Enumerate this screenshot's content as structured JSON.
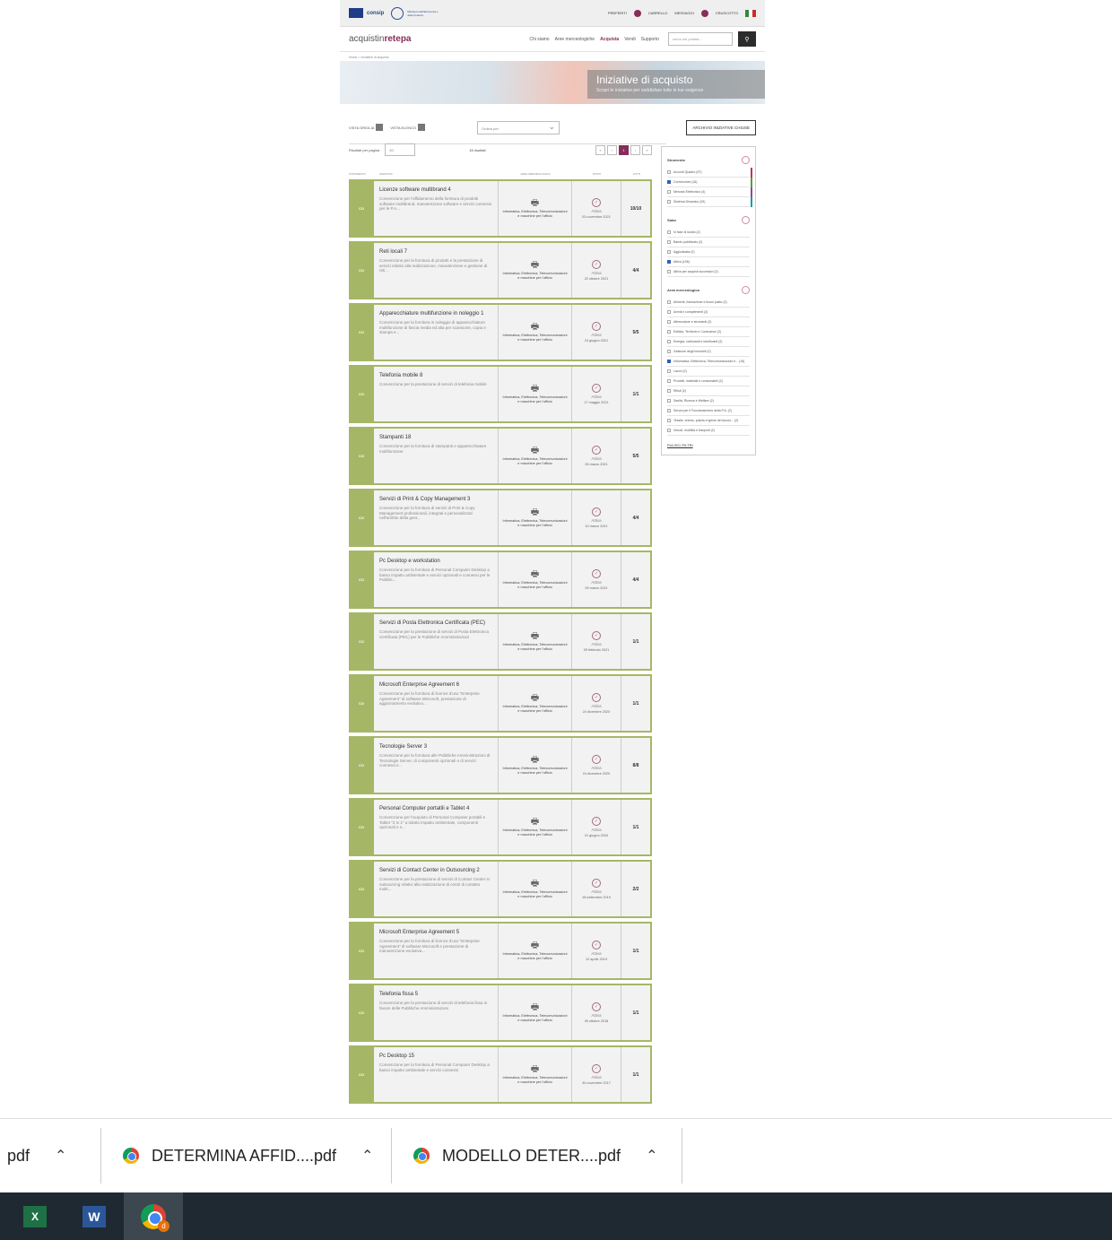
{
  "site": {
    "topbar": {
      "consip": "consip",
      "mef": "MEF",
      "mef_sub": "Ministero dell'Economia e delle Finanze",
      "links": [
        "Preferiti",
        "Carrello",
        "Messaggi",
        "Cruscotto"
      ]
    },
    "header": {
      "logo_a": "acquistin",
      "logo_b": "retepa",
      "nav": [
        "Chi siamo",
        "Aree merceologiche",
        "Acquista",
        "Vendi",
        "Supporto"
      ],
      "search_placeholder": "cerca nel portale..."
    },
    "breadcrumb": "Home > Iniziative di acquisto",
    "hero": {
      "title": "Iniziative di acquisto",
      "subtitle": "Scopri le iniziative per soddisfare tutte le tue esigenze"
    },
    "toolbar": {
      "view_grid": "VISTA GRIGLIA",
      "view_list": "VISTA ELENCO",
      "sort": "Ordina per",
      "archive": "ARCHIVIO INIZIATIVE CHIUSE"
    },
    "list": {
      "per_page_label": "Risultati per pagina",
      "per_page": "20",
      "results": "16 risultati",
      "pages": [
        "«",
        "‹",
        "1",
        "›",
        "»"
      ],
      "columns": [
        "Strumento",
        "Iniziativa",
        "Area merceologica",
        "Stato",
        "Lotti"
      ],
      "cards": [
        {
          "tag": "CO",
          "title": "Licenze software multibrand 4",
          "desc": "Convenzione per l'affidamento della fornitura di prodotti software multibrand, manutenzione software e servizi connessi per le P.A...",
          "cat": "Informatica, Elettronica, Telecomunicazioni e macchine per l'ufficio",
          "status": "Attiva",
          "date": "03 novembre 2021",
          "lots": "10/10"
        },
        {
          "tag": "CO",
          "title": "Reti locali 7",
          "desc": "Convenzione per la fornitura di prodotti e la prestazione di servizi relativi alla realizzazione, manutenzione e gestione di reti...",
          "cat": "Informatica, Elettronica, Telecomunicazioni e macchine per l'ufficio",
          "status": "Attiva",
          "date": "22 ottobre 2021",
          "lots": "4/4"
        },
        {
          "tag": "CO",
          "title": "Apparecchiature multifunzione in noleggio 1",
          "desc": "Convenzione per la fornitura in noleggio di apparecchiature multifunzione di fascia media ed alta per scansione, copia e stampa e...",
          "cat": "Informatica, Elettronica, Telecomunicazioni e macchine per l'ufficio",
          "status": "Attiva",
          "date": "24 giugno 2021",
          "lots": "5/5"
        },
        {
          "tag": "CO",
          "title": "Telefonia mobile 8",
          "desc": "Convenzione per la prestazione di servizi di telefonia mobile",
          "cat": "Informatica, Elettronica, Telecomunicazioni e macchine per l'ufficio",
          "status": "Attiva",
          "date": "17 maggio 2021",
          "lots": "1/1"
        },
        {
          "tag": "CO",
          "title": "Stampanti 18",
          "desc": "Convenzione per la fornitura di stampanti e apparecchiature multifunzione",
          "cat": "Informatica, Elettronica, Telecomunicazioni e macchine per l'ufficio",
          "status": "Attiva",
          "date": "26 marzo 2021",
          "lots": "5/5"
        },
        {
          "tag": "CO",
          "title": "Servizi di Print & Copy Management 3",
          "desc": "Convenzione per la fornitura di servizi di Print & Copy Management professionali, integrati e personalizzati nell'ambito della gest...",
          "cat": "Informatica, Elettronica, Telecomunicazioni e macchine per l'ufficio",
          "status": "Attiva",
          "date": "10 marzo 2021",
          "lots": "4/4"
        },
        {
          "tag": "CO",
          "title": "Pc Desktop e workstation",
          "desc": "Convenzione per la fornitura di Personal Computer Desktop a basso impatto ambientale e servizi opzionali e connessi per le Pubblic...",
          "cat": "Informatica, Elettronica, Telecomunicazioni e macchine per l'ufficio",
          "status": "Attiva",
          "date": "05 marzo 2021",
          "lots": "4/4"
        },
        {
          "tag": "CO",
          "title": "Servizi di Posta Elettronica Certificata (PEC)",
          "desc": "Convenzione per la prestazione di servizi di Posta Elettronica Certificata (PEC) per le Pubbliche Amministrazioni",
          "cat": "Informatica, Elettronica, Telecomunicazioni e macchine per l'ufficio",
          "status": "Attiva",
          "date": "09 febbraio 2021",
          "lots": "1/1"
        },
        {
          "tag": "CO",
          "title": "Microsoft Enterprise Agreement 6",
          "desc": "Convenzione per la fornitura di licenze d'uso \"Enterprise Agreement\" di software Microsoft, prestazione di aggiornamento evolutivo...",
          "cat": "Informatica, Elettronica, Telecomunicazioni e macchine per l'ufficio",
          "status": "Attiva",
          "date": "24 dicembre 2020",
          "lots": "1/1"
        },
        {
          "tag": "CO",
          "title": "Tecnologie Server 3",
          "desc": "Convenzione per la fornitura alle Pubbliche Amministrazioni di Tecnologie Server, di componenti opzionali e di servizi connessi e...",
          "cat": "Informatica, Elettronica, Telecomunicazioni e macchine per l'ufficio",
          "status": "Attiva",
          "date": "24 dicembre 2020",
          "lots": "8/8"
        },
        {
          "tag": "CO",
          "title": "Personal Computer portatili e Tablet 4",
          "desc": "Convenzione per l'acquisto di Personal Computer portatili e Tablet \"2 in 1\" a ridotto impatto ambientale, componenti opzionali e s...",
          "cat": "Informatica, Elettronica, Telecomunicazioni e macchine per l'ufficio",
          "status": "Attiva",
          "date": "01 giugno 2020",
          "lots": "1/1"
        },
        {
          "tag": "CO",
          "title": "Servizi di Contact Center in Outsourcing 2",
          "desc": "Convenzione per la prestazione di servizi di Contact Center in outsourcing relativi alla realizzazione di centri di contatto multi...",
          "cat": "Informatica, Elettronica, Telecomunicazioni e macchine per l'ufficio",
          "status": "Attiva",
          "date": "18 settembre 2019",
          "lots": "2/2"
        },
        {
          "tag": "CO",
          "title": "Microsoft Enterprise Agreement 5",
          "desc": "Convenzione per la fornitura di licenze d'uso \"Enterprise Agreement\" di software Microsoft e prestazione di manutenzione evolutiva...",
          "cat": "Informatica, Elettronica, Telecomunicazioni e macchine per l'ufficio",
          "status": "Attiva",
          "date": "12 aprile 2019",
          "lots": "1/1"
        },
        {
          "tag": "CO",
          "title": "Telefonia fissa 5",
          "desc": "Convenzione per la prestazione di servizi di telefonia fissa in favore delle Pubbliche Amministrazioni",
          "cat": "Informatica, Elettronica, Telecomunicazioni e macchine per l'ufficio",
          "status": "Attiva",
          "date": "05 ottobre 2018",
          "lots": "1/1"
        },
        {
          "tag": "CO",
          "title": "Pc Desktop 15",
          "desc": "Convenzione per la fornitura di Personal Computer Desktop a basso impatto ambientale e servizi connessi",
          "cat": "Informatica, Elettronica, Telecomunicazioni e macchine per l'ufficio",
          "status": "Attiva",
          "date": "30 novembre 2017",
          "lots": "1/1"
        }
      ]
    },
    "filters": {
      "g1_title": "Strumento",
      "g1": [
        "Accordi Quadro (57)",
        "Convenzioni (16)",
        "Mercato Elettronico (4)",
        "Sistema Dinamico (29)"
      ],
      "g2_title": "Stato",
      "g2": [
        "In fase di studio (2)",
        "Bando pubblicato (2)",
        "Aggiudicata (2)",
        "Attiva (106)",
        "Attiva per acquisti successivi (2)"
      ],
      "g3_title": "Area merceologica",
      "g3": [
        "Alimenti, ristorazione e buoni pasto (2)",
        "Arredi e complementi (2)",
        "Attrezzature e strumenti (2)",
        "Edilizia, Territorio e Costruzioni (2)",
        "Energia, carburanti e lubrificanti (2)",
        "Gestione degli Immobili (2)",
        "Informatica, Elettronica, Telecomunicazioni e... (16)",
        "Lavori (2)",
        "Prodotti, materiali e consumabili (2)",
        "Rifiuti (2)",
        "Sanità, Ricerca e Welfare (2)",
        "Servizi per il Funzionamento della P.A. (2)",
        "Tessile, arredo, pulizia e igiene del lavoro... (2)",
        "Veicoli, mobilità e trasporti (2)"
      ],
      "reset": "PULISCI FILTRI"
    }
  },
  "downloads": [
    {
      "label": "pdf"
    },
    {
      "label": "DETERMINA AFFID....pdf"
    },
    {
      "label": "MODELLO DETER....pdf"
    }
  ],
  "taskbar": {
    "excel": "X",
    "word": "W",
    "chrome_badge": "d"
  },
  "colors": {
    "accent": "#862d59",
    "card_green": "#a5b766",
    "taskbar": "#1f2932"
  }
}
